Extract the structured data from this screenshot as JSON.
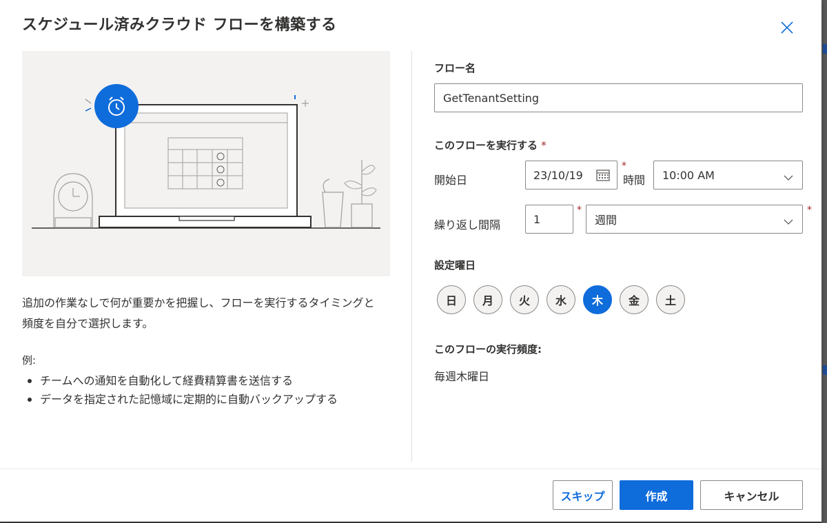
{
  "dialog": {
    "title": "スケジュール済みクラウド フローを構築する",
    "close_icon": "close-icon"
  },
  "left": {
    "description": "追加の作業なしで何が重要かを把握し、フローを実行するタイミングと頻度を自分で選択します。",
    "example_label": "例:",
    "examples": [
      "チームへの通知を自動化して経費精算書を送信する",
      "データを指定された記憶域に定期的に自動バックアップする"
    ]
  },
  "form": {
    "flow_name_label": "フロー名",
    "flow_name_value": "GetTenantSetting",
    "run_label": "このフローを実行する",
    "required_mark": "*",
    "start_date_label": "開始日",
    "start_date_value": "23/10/19",
    "time_label": "時間",
    "time_value": "10:00 AM",
    "repeat_label": "繰り返し間隔",
    "repeat_value": "1",
    "repeat_unit_value": "週間",
    "weekday_label": "設定曜日",
    "weekdays": [
      {
        "label": "日",
        "selected": false
      },
      {
        "label": "月",
        "selected": false
      },
      {
        "label": "火",
        "selected": false
      },
      {
        "label": "水",
        "selected": false
      },
      {
        "label": "木",
        "selected": true
      },
      {
        "label": "金",
        "selected": false
      },
      {
        "label": "土",
        "selected": false
      }
    ],
    "frequency_label": "このフローの実行頻度:",
    "frequency_value": "毎週木曜日"
  },
  "footer": {
    "skip_label": "スキップ",
    "create_label": "作成",
    "cancel_label": "キャンセル"
  },
  "colors": {
    "accent": "#0f6cdb",
    "required": "#a4262c"
  }
}
